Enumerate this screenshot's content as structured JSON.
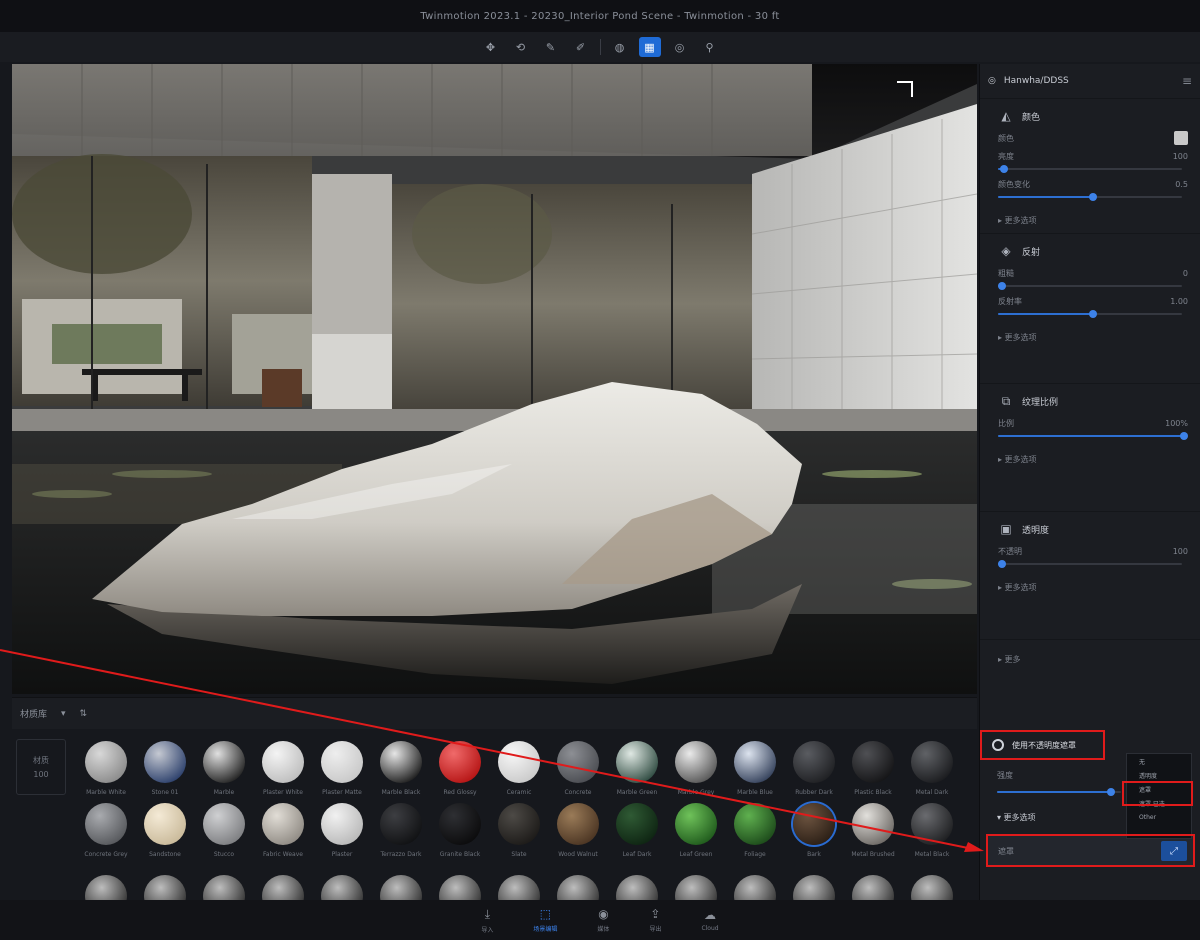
{
  "window": {
    "title": "Twinmotion 2023.1 - 20230_Interior Pond Scene - Twinmotion - 30 ft"
  },
  "toolbar": {
    "buttons": [
      {
        "name": "move-tool-icon",
        "glyph": "✥"
      },
      {
        "name": "rotate-tool-icon",
        "glyph": "⟲"
      },
      {
        "name": "paint-tool-icon",
        "glyph": "✎"
      },
      {
        "name": "picker-tool-icon",
        "glyph": "✐"
      },
      {
        "name": "globe-icon",
        "glyph": "◍"
      },
      {
        "name": "perspective-icon",
        "glyph": "▦",
        "active": true
      },
      {
        "name": "camera-icon",
        "glyph": "◎"
      },
      {
        "name": "walk-icon",
        "glyph": "⚲"
      }
    ]
  },
  "right_panel": {
    "header": "Hanwha/DDSS",
    "sections": [
      {
        "title": "颜色",
        "icon": "◭",
        "rows": [
          {
            "label": "颜色",
            "value": ""
          },
          {
            "label": "亮度",
            "value": "100"
          },
          {
            "label": "颜色变化",
            "value": "0.5"
          }
        ],
        "sliders": [
          0.03,
          0.5
        ],
        "expand": "▸ 更多选项",
        "swatch": true
      },
      {
        "title": "反射",
        "icon": "◈",
        "rows": [
          {
            "label": "粗糙",
            "value": "0"
          },
          {
            "label": "反射率",
            "value": "1.00"
          }
        ],
        "sliders": [
          0.02,
          0.5
        ],
        "expand": "▸ 更多选项"
      },
      {
        "title": "纹理比例",
        "icon": "⧉",
        "rows": [
          {
            "label": "比例",
            "value": "100%"
          }
        ],
        "sliders": [
          0.98
        ],
        "expand": "▸ 更多选项"
      },
      {
        "title": "透明度",
        "icon": "▣",
        "rows": [
          {
            "label": "不透明",
            "value": "100"
          }
        ],
        "sliders": [
          0.02
        ],
        "expand": "▸ 更多选项"
      }
    ],
    "more_label": "▸ 更多",
    "mask": {
      "title": "使用不透明度遮罩",
      "slider_label": "强度",
      "expand_label": "▾ 更多选项",
      "field_label": "遮罩",
      "dropdown": [
        "无",
        "透明度",
        "遮罩",
        "遮罩 已选",
        "Other"
      ]
    }
  },
  "library": {
    "header_label": "材质库",
    "header_icons": [
      "filter-icon",
      "sort-icon"
    ],
    "side_label": "材质",
    "side_sub": "100",
    "row1": [
      {
        "label": "Marble White",
        "c1": "#d8d8d8",
        "c2": "#8a8a8a"
      },
      {
        "label": "Stone 01",
        "c1": "#c5c9d2",
        "c2": "#2b3f6b"
      },
      {
        "label": "Marble",
        "c1": "#e0e0e0",
        "c2": "#222222"
      },
      {
        "label": "Plaster White",
        "c1": "#f4f4f4",
        "c2": "#bdbdbd"
      },
      {
        "label": "Plaster Matte",
        "c1": "#eeeeee",
        "c2": "#c8c8c8"
      },
      {
        "label": "Marble Black",
        "c1": "#e6e6e6",
        "c2": "#1d1d1d"
      },
      {
        "label": "Red Glossy",
        "c1": "#f06a6a",
        "c2": "#b51414"
      },
      {
        "label": "Ceramic",
        "c1": "#f7f7f7",
        "c2": "#c9c9c9"
      },
      {
        "label": "Concrete",
        "c1": "#8d8f94",
        "c2": "#4a4c51"
      },
      {
        "label": "Marble Green",
        "c1": "#dfe8e3",
        "c2": "#2e4a40"
      },
      {
        "label": "Marble Grey",
        "c1": "#eaeaea",
        "c2": "#555555"
      },
      {
        "label": "Marble Blue",
        "c1": "#dce3ee",
        "c2": "#33405a"
      },
      {
        "label": "Rubber Dark",
        "c1": "#5a5c61",
        "c2": "#1e1f22"
      },
      {
        "label": "Plastic Black",
        "c1": "#4f5054",
        "c2": "#141416"
      },
      {
        "label": "Metal Dark",
        "c1": "#606266",
        "c2": "#1a1b1e"
      }
    ],
    "row2": [
      {
        "label": "Concrete Grey",
        "c1": "#a9abaf",
        "c2": "#55575b"
      },
      {
        "label": "Sandstone",
        "c1": "#f4ead6",
        "c2": "#c9b999"
      },
      {
        "label": "Stucco",
        "c1": "#cfd0d2",
        "c2": "#7c7d80"
      },
      {
        "label": "Fabric Weave",
        "c1": "#e1ddd6",
        "c2": "#8f8a83"
      },
      {
        "label": "Plaster",
        "c1": "#f1f1f1",
        "c2": "#b8b8b8"
      },
      {
        "label": "Terrazzo Dark",
        "c1": "#3d3e42",
        "c2": "#101113"
      },
      {
        "label": "Granite Black",
        "c1": "#2e2f33",
        "c2": "#0b0b0c"
      },
      {
        "label": "Slate",
        "c1": "#4d4a46",
        "c2": "#1c1a18"
      },
      {
        "label": "Wood Walnut",
        "c1": "#9a7b58",
        "c2": "#4a3422"
      },
      {
        "label": "Leaf Dark",
        "c1": "#2f5a34",
        "c2": "#0e2412"
      },
      {
        "label": "Leaf Green",
        "c1": "#6fc25a",
        "c2": "#1f5a1c"
      },
      {
        "label": "Foliage",
        "c1": "#5fb04f",
        "c2": "#1c4a1a"
      },
      {
        "label": "Bark",
        "c1": "#6d5440",
        "c2": "#2a1e15",
        "selected": true
      },
      {
        "label": "Metal Brushed",
        "c1": "#e2e0dc",
        "c2": "#6c6864"
      },
      {
        "label": "Metal Black",
        "c1": "#6a6b6f",
        "c2": "#1d1e20"
      }
    ]
  },
  "bottom_nav": [
    {
      "label": "导入",
      "icon": "⤓",
      "name": "nav-import"
    },
    {
      "label": "场景编辑",
      "icon": "⬚",
      "name": "nav-edit",
      "active": true
    },
    {
      "label": "媒体",
      "icon": "◉",
      "name": "nav-media"
    },
    {
      "label": "导出",
      "icon": "⇪",
      "name": "nav-export"
    },
    {
      "label": "Cloud",
      "icon": "☁",
      "name": "nav-cloud"
    }
  ]
}
